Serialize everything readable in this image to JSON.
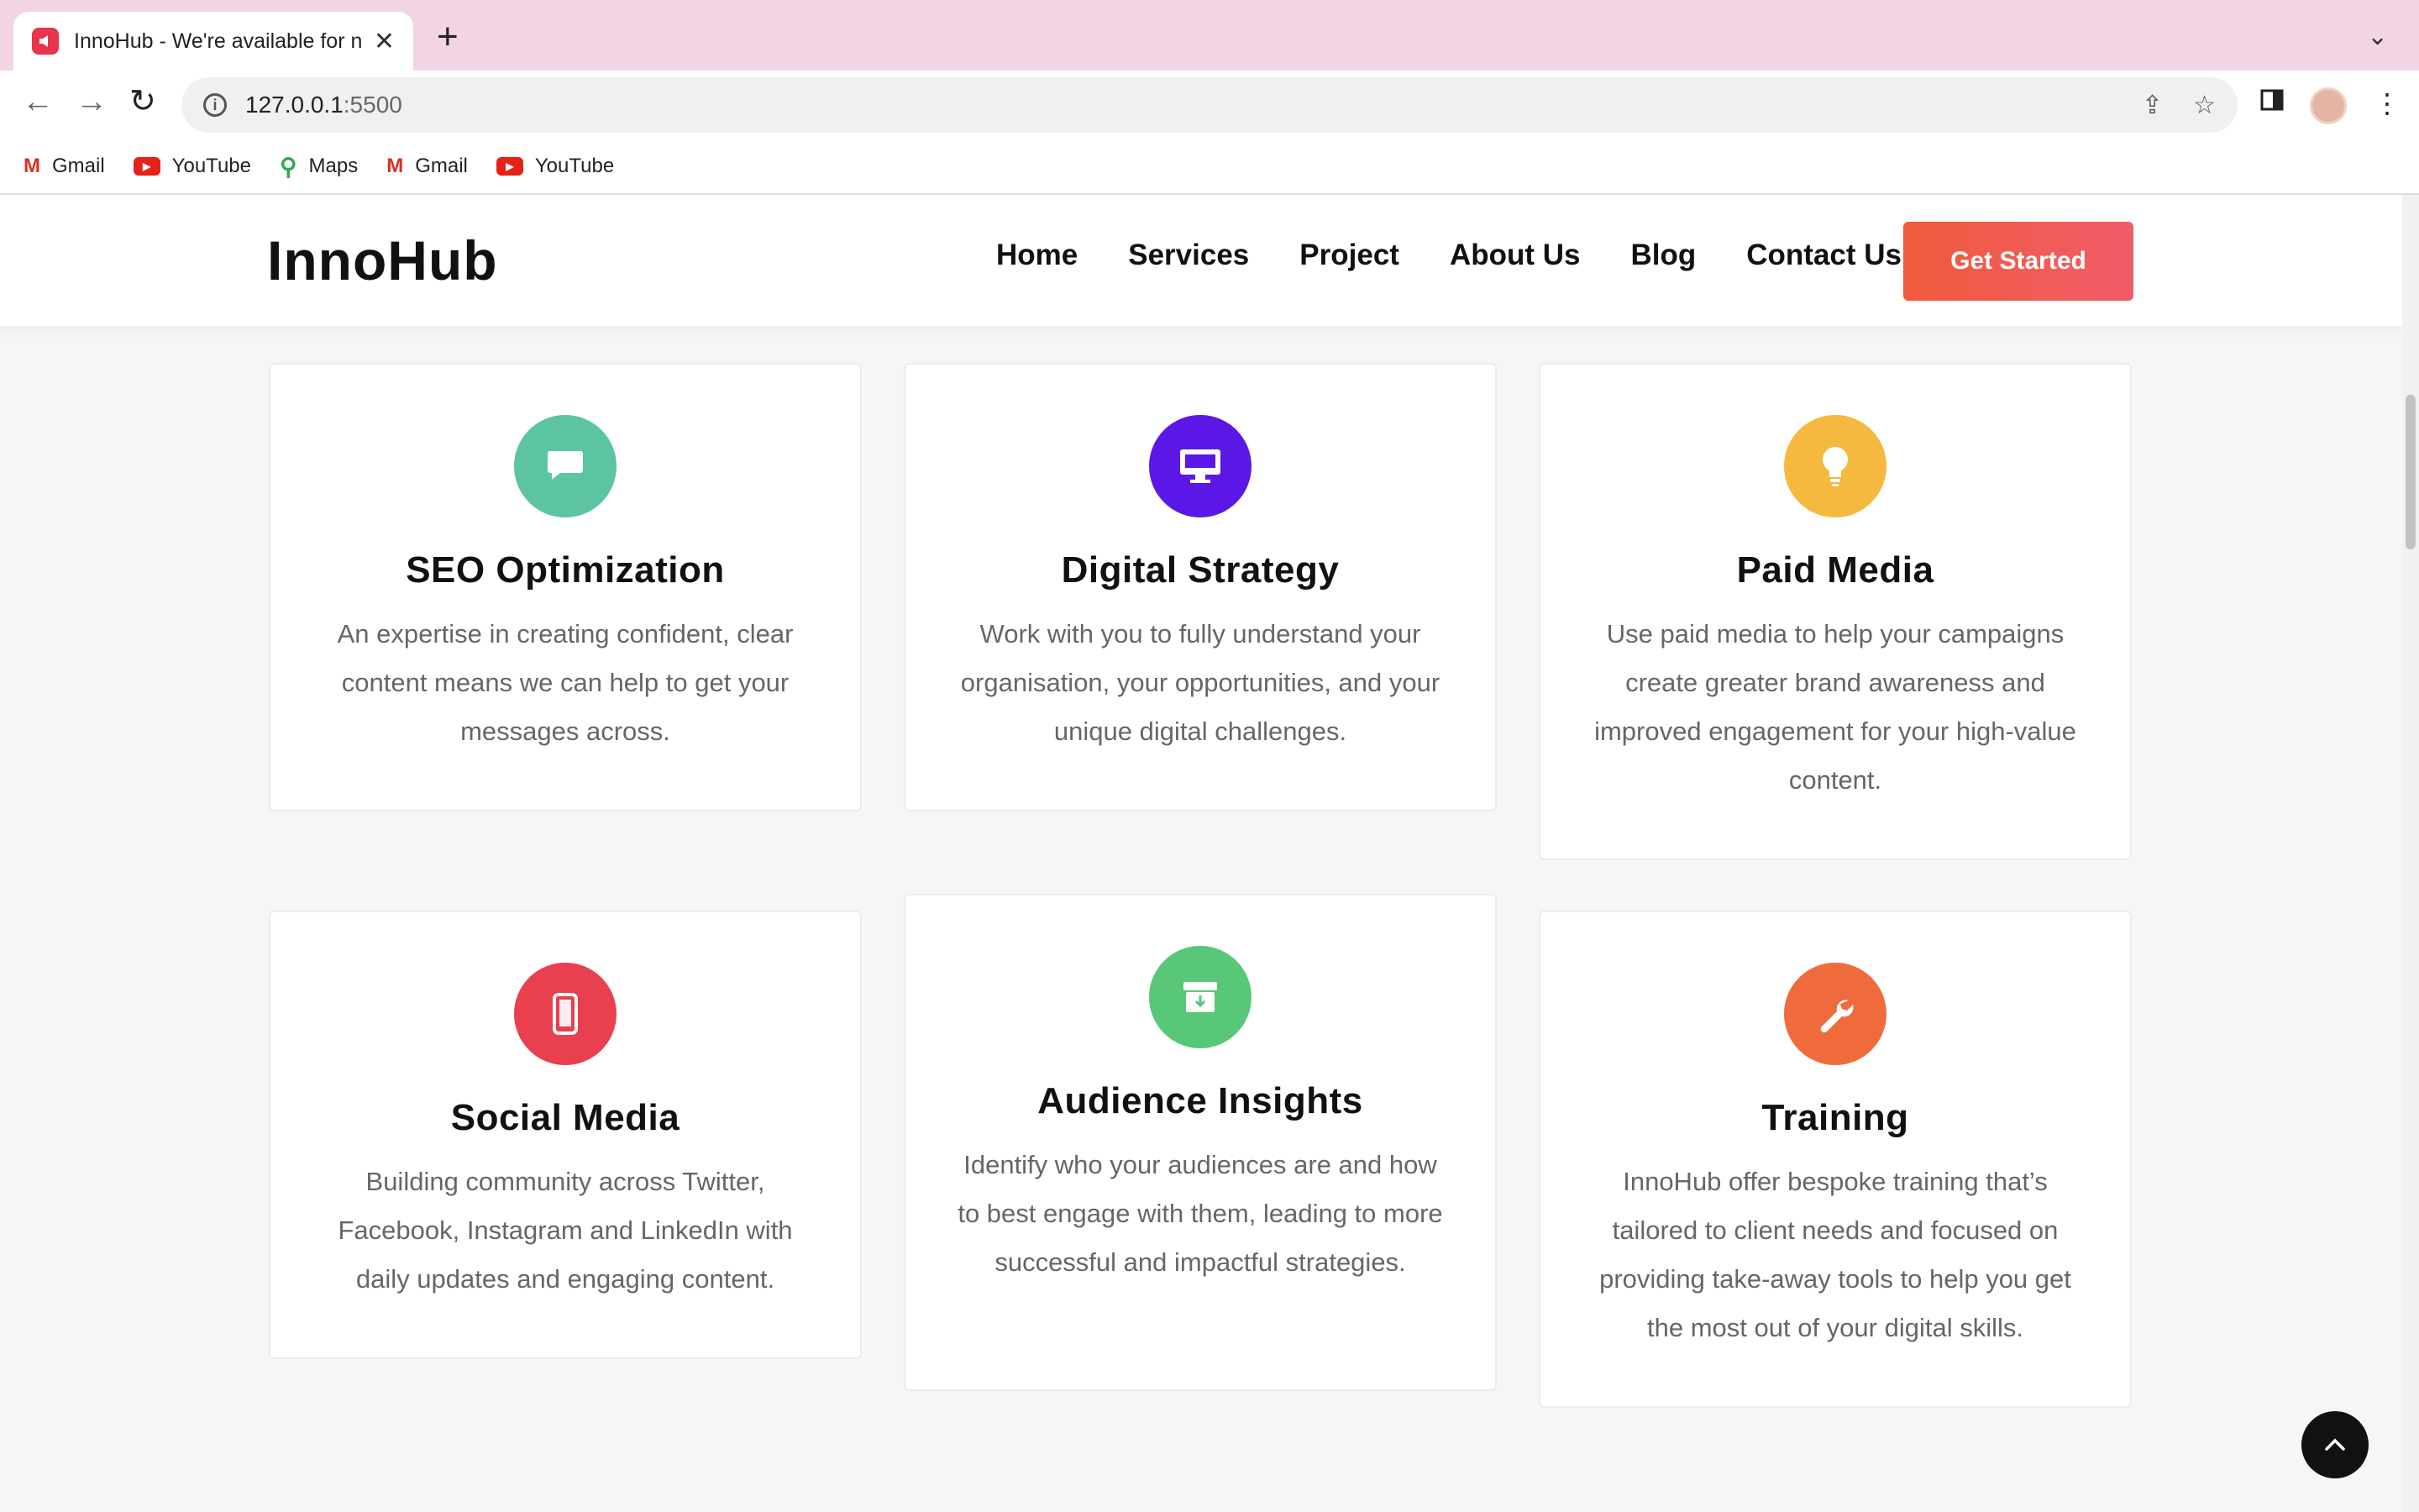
{
  "browser": {
    "tab_title": "InnoHub - We're available for n",
    "url_host": "127.0.0.1",
    "url_port": ":5500",
    "bookmarks": [
      {
        "label": "Gmail",
        "icon": "gmail-icon"
      },
      {
        "label": "YouTube",
        "icon": "youtube-icon"
      },
      {
        "label": "Maps",
        "icon": "maps-icon"
      },
      {
        "label": "Gmail",
        "icon": "gmail-icon"
      },
      {
        "label": "YouTube",
        "icon": "youtube-icon"
      }
    ]
  },
  "site": {
    "logo": "InnoHub",
    "nav": [
      "Home",
      "Services",
      "Project",
      "About Us",
      "Blog",
      "Contact Us"
    ],
    "cta": "Get Started"
  },
  "services": [
    {
      "title": "SEO Optimization",
      "desc": "An expertise in creating confident, clear content means we can help to get your messages across.",
      "icon": "chat-icon",
      "color": "#5cc4a0"
    },
    {
      "title": "Digital Strategy",
      "desc": "Work with you to fully understand your organisation, your opportunities, and your unique digital challenges.",
      "icon": "monitor-icon",
      "color": "#5a17e6"
    },
    {
      "title": "Paid Media",
      "desc": "Use paid media to help your campaigns create greater brand awareness and improved engagement for your high-value content.",
      "icon": "lightbulb-icon",
      "color": "#f4b93e"
    },
    {
      "title": "Social Media",
      "desc": "Building community across Twitter, Facebook, Instagram and LinkedIn with daily updates and engaging content.",
      "icon": "phone-icon",
      "color": "#e8404e"
    },
    {
      "title": "Audience Insights",
      "desc": "Identify who your audiences are and how to best engage with them, leading to more successful and impactful strategies.",
      "icon": "archive-icon",
      "color": "#58c878"
    },
    {
      "title": "Training",
      "desc": "InnoHub offer bespoke training that’s tailored to client needs and focused on providing take-away tools to help you get the most out of your digital skills.",
      "icon": "wrench-icon",
      "color": "#ef6b3c"
    }
  ]
}
